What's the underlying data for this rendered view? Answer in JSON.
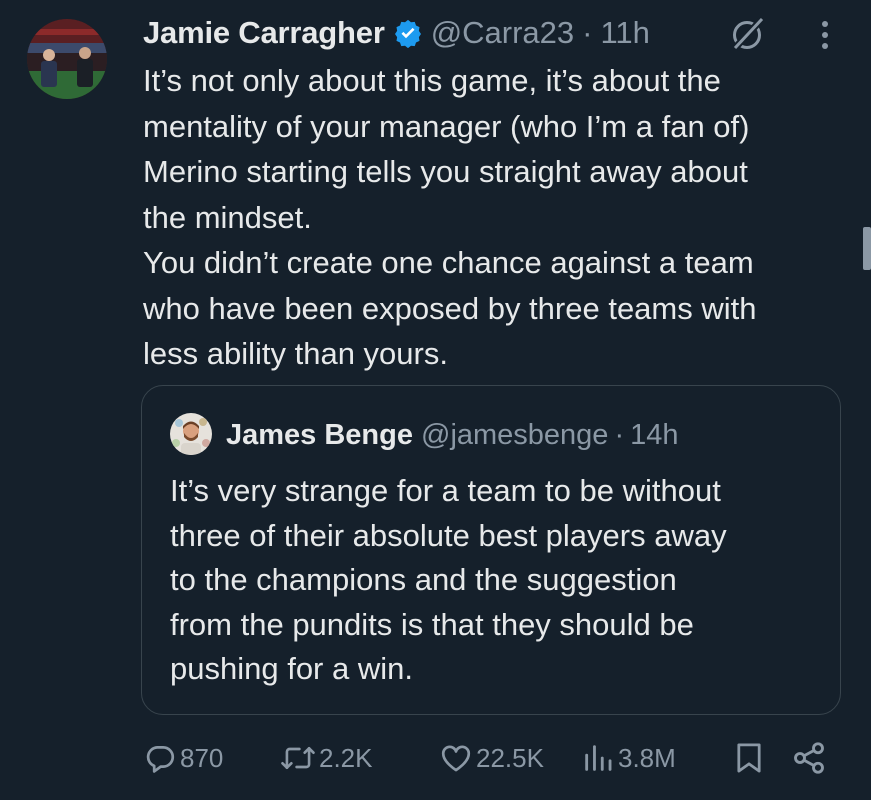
{
  "tweet": {
    "author": {
      "name": "Jamie Carragher",
      "handle": "@Carra23",
      "verified": true
    },
    "separator": "·",
    "time": "11h",
    "lines": [
      "It’s not only about this game, it’s about the",
      "mentality of your manager (who I’m a fan of)",
      "Merino starting tells you straight away about",
      "the mindset.",
      "You didn’t create one chance against a team",
      "who have been exposed by three teams with",
      "less ability than yours."
    ]
  },
  "quoted_tweet": {
    "author": {
      "name": "James Benge",
      "handle": "@jamesbenge"
    },
    "separator": "·",
    "time": "14h",
    "lines": [
      "It’s very strange for a team to be without",
      "three of their absolute best players away",
      "to the champions and the suggestion",
      "from the pundits is that they should be",
      "pushing for a win."
    ]
  },
  "actions": {
    "replies": "870",
    "reposts": "2.2K",
    "likes": "22.5K",
    "views": "3.8M"
  },
  "icons": {
    "verified": "verified-badge-icon",
    "grok": "grok-icon",
    "more": "more-vertical-icon",
    "reply": "reply-icon",
    "repost": "repost-icon",
    "like": "heart-icon",
    "views": "views-chart-icon",
    "bookmark": "bookmark-icon",
    "share": "share-icon"
  },
  "colors": {
    "background": "#15202b",
    "text": "#e7e9ea",
    "secondary": "#8b98a5",
    "verified": "#1d9bf0",
    "border": "#38444d"
  }
}
